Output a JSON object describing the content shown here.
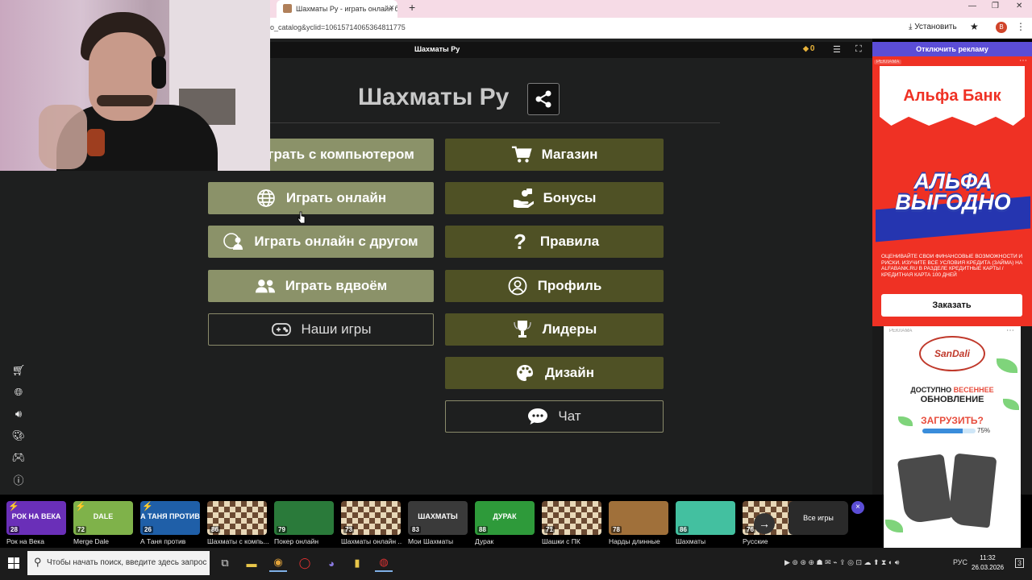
{
  "browser": {
    "tab_title": "Шахматы Ру - играть онлайн б...",
    "url": "o_catalog&yclid=10615714065364811775",
    "install_label": "Установить",
    "account_initial": "В"
  },
  "game_header": {
    "title": "Шахматы Ру",
    "coins": "0"
  },
  "main": {
    "heading": "Шахматы Ру",
    "left_buttons": [
      {
        "label": "Играть с компьютером",
        "icon": "robot-icon"
      },
      {
        "label": "Играть онлайн",
        "icon": "globe-icon"
      },
      {
        "label": "Играть онлайн с другом",
        "icon": "users-globe-icon"
      },
      {
        "label": "Играть вдвоём",
        "icon": "users-icon"
      },
      {
        "label": "Наши игры",
        "icon": "gamepad-icon"
      }
    ],
    "right_buttons": [
      {
        "label": "Магазин",
        "icon": "cart-icon"
      },
      {
        "label": "Бонусы",
        "icon": "bonus-hand-icon"
      },
      {
        "label": "Правила",
        "icon": "question-icon"
      },
      {
        "label": "Профиль",
        "icon": "user-circle-icon"
      },
      {
        "label": "Лидеры",
        "icon": "trophy-icon"
      },
      {
        "label": "Дизайн",
        "icon": "palette-icon"
      },
      {
        "label": "Чат",
        "icon": "chat-icon"
      }
    ]
  },
  "sidebar_icons": [
    "cart-icon",
    "globe-icon",
    "sound-icon",
    "palette-icon",
    "gamepad-icon",
    "info-icon"
  ],
  "ads": {
    "disable_ads": "Отключить рекламу",
    "ad_label": "РЕКЛАМА",
    "alfa_brand": "Альфа Банк",
    "alfa_slogan_1": "АЛЬФА",
    "alfa_slogan_2": "ВЫГОДНО",
    "alfa_fine": "ОЦЕНИВАЙТЕ СВОИ ФИНАНСОВЫЕ ВОЗМОЖНОСТИ И РИСКИ. ИЗУЧИТЕ ВСЕ УСЛОВИЯ КРЕДИТА (ЗАЙМА) НА ALFABANK.RU В РАЗДЕЛЕ КРЕДИТНЫЕ КАРТЫ / КРЕДИТНАЯ КАРТА 100 ДНЕЙ",
    "order_button": "Заказать",
    "sandali_brand": "SanDali",
    "update_line1_a": "ДОСТУПНО ",
    "update_line1_b": "ВЕСЕННЕЕ",
    "update_line2": "ОБНОВЛЕНИЕ",
    "load_label": "ЗАГРУЗИТЬ?",
    "load_progress": 0.75,
    "load_percent": "75%"
  },
  "games_strip": {
    "games": [
      {
        "name": "Рок на Века",
        "rating": "28",
        "card_text": "РОК НА ВЕКА",
        "color": "#6a2fb8",
        "bolt": true
      },
      {
        "name": "Merge Dale",
        "rating": "72",
        "card_text": "DALE",
        "color": "#7fb24a",
        "bolt": true
      },
      {
        "name": "А Таня против",
        "rating": "26",
        "card_text": "А ТАНЯ ПРОТИВ",
        "color": "#1f5fa8",
        "bolt": true
      },
      {
        "name": "Шахматы с компь...",
        "rating": "86",
        "card_text": "",
        "color": "board",
        "bolt": false
      },
      {
        "name": "Покер онлайн",
        "rating": "79",
        "card_text": "",
        "color": "#2a7a3a",
        "bolt": false
      },
      {
        "name": "Шахматы онлайн ...",
        "rating": "73",
        "card_text": "",
        "color": "board",
        "bolt": false
      },
      {
        "name": "Мои Шахматы",
        "rating": "83",
        "card_text": "ШАХМАТЫ",
        "color": "#3a3a3a",
        "bolt": false
      },
      {
        "name": "Дурак",
        "rating": "88",
        "card_text": "ДУРАК",
        "color": "#2e9a3a",
        "bolt": false
      },
      {
        "name": "Шашки с ПК",
        "rating": "71",
        "card_text": "",
        "color": "board",
        "bolt": false
      },
      {
        "name": "Нарды длинные",
        "rating": "78",
        "card_text": "",
        "color": "#a0703a",
        "bolt": false
      },
      {
        "name": "Шахматы",
        "rating": "86",
        "card_text": "",
        "color": "#43c0a0",
        "bolt": false
      },
      {
        "name": "Русские",
        "rating": "76",
        "card_text": "",
        "color": "board",
        "bolt": false
      }
    ],
    "all_games": "Все игры"
  },
  "taskbar": {
    "search_placeholder": "Чтобы начать поиск, введите здесь запрос",
    "lang": "РУС",
    "time": "11:32",
    "date": "26.03.2026",
    "notif_count": "3"
  }
}
